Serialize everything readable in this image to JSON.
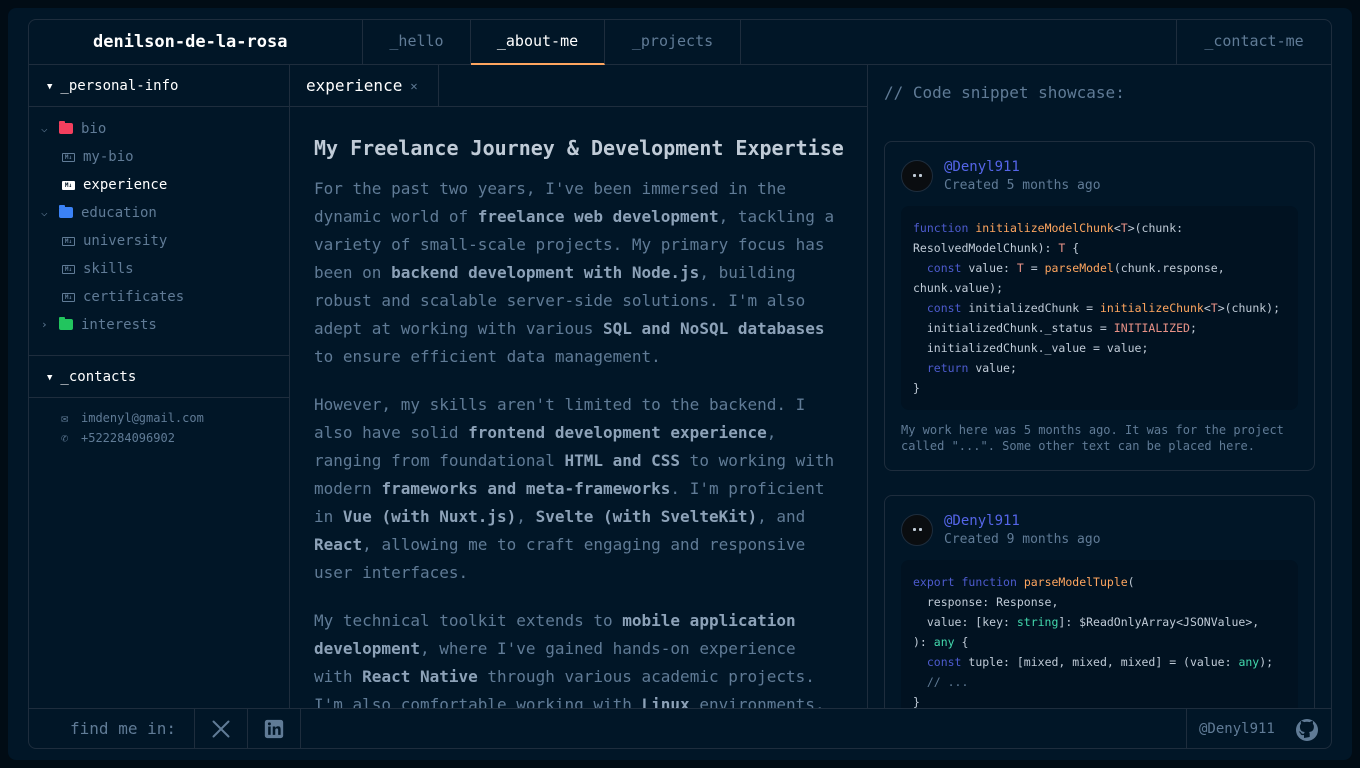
{
  "header": {
    "brand": "denilson-de-la-rosa",
    "tabs": [
      {
        "label": "_hello"
      },
      {
        "label": "_about-me"
      },
      {
        "label": "_projects"
      }
    ],
    "contact": "_contact-me"
  },
  "sidebar": {
    "personal_header": "_personal-info",
    "tree": {
      "bio": "bio",
      "my_bio": "my-bio",
      "experience": "experience",
      "education": "education",
      "university": "university",
      "skills": "skills",
      "certificates": "certificates",
      "interests": "interests"
    },
    "contacts_header": "_contacts",
    "email": "imdenyl@gmail.com",
    "phone": "+522284096902"
  },
  "editor": {
    "tab": "experience",
    "title": "My Freelance Journey & Development Expertise",
    "p1": {
      "t1": "For the past two years, I've been immersed in the dynamic world of ",
      "b1": "freelance web development",
      "t2": ", tackling a variety of small-scale projects. My primary focus has been on ",
      "b2": "backend development with Node.js",
      "t3": ", building robust and scalable server-side solutions. I'm also adept at working with various ",
      "b3": "SQL and NoSQL databases",
      "t4": " to ensure efficient data management."
    },
    "p2": {
      "t1": "However, my skills aren't limited to the backend. I also have solid ",
      "b1": "frontend development experience",
      "t2": ", ranging from foundational ",
      "b2": "HTML and CSS",
      "t3": " to working with modern ",
      "b3": "frameworks and meta-frameworks",
      "t4": ". I'm proficient in ",
      "b4": "Vue (with Nuxt.js)",
      "t5": ", ",
      "b5": "Svelte (with SvelteKit)",
      "t6": ", and ",
      "b6": "React",
      "t7": ", allowing me to craft engaging and responsive user interfaces."
    },
    "p3": {
      "t1": "My technical toolkit extends to ",
      "b1": "mobile application development",
      "t2": ", where I've gained hands-on experience with ",
      "b2": "React Native",
      "t3": " through various academic projects. I'm also comfortable working with ",
      "b3": "Linux",
      "t4": " environments, and"
    }
  },
  "showcase": {
    "title": "// Code snippet showcase:",
    "snippets": [
      {
        "user": "@Denyl911",
        "created": "Created 5 months ago",
        "note": "My work here was 5 months ago. It was for the project called \"...\". Some other text can be placed here."
      },
      {
        "user": "@Denyl911",
        "created": "Created 9 months ago"
      }
    ]
  },
  "footer": {
    "findme": "find me in:",
    "github_user": "@Denyl911"
  },
  "colors": {
    "background": "#011627",
    "border": "#1e2d3d",
    "accent": "#fea55f",
    "folder_bio": "#e99287",
    "folder_education": "#3a49a4",
    "folder_interests": "#43d9ad"
  }
}
